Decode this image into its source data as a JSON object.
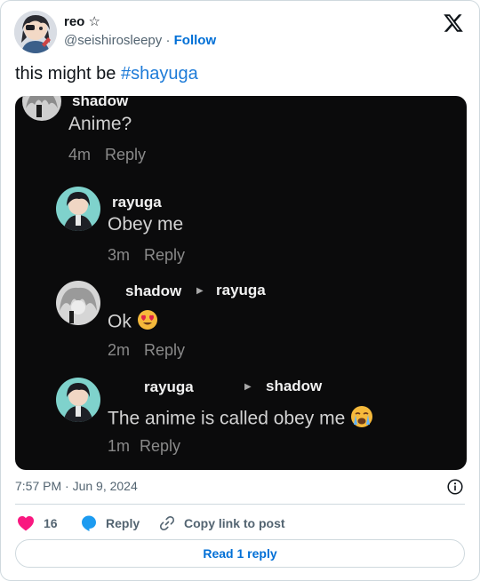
{
  "author": {
    "name": "reo",
    "badge": "☆",
    "handle": "@seishirosleepy",
    "separator": "·",
    "follow_label": "Follow"
  },
  "tweet": {
    "text": "this might be ",
    "hashtag": "#shayuga"
  },
  "media": {
    "comments": [
      {
        "user": "shadow",
        "text": "Anime?",
        "time": "4m",
        "reply": "Reply"
      },
      {
        "user": "rayuga",
        "text": "Obey me",
        "time": "3m",
        "reply": "Reply"
      },
      {
        "user": "shadow",
        "to": "rayuga",
        "text": "Ok",
        "emoji": "heart-eyes",
        "time": "2m",
        "reply": "Reply"
      },
      {
        "user": "rayuga",
        "to": "shadow",
        "text": "The anime is called obey me",
        "emoji": "crying",
        "time": "1m",
        "reply": "Reply"
      }
    ]
  },
  "footer": {
    "timestamp": "7:57 PM · Jun 9, 2024",
    "like_count": "16",
    "reply_label": "Reply",
    "copy_label": "Copy link to post",
    "read_replies_label": "Read 1 reply"
  },
  "colors": {
    "accent": "#006fd6",
    "hashtag": "#1d7bd8",
    "like": "#f91880",
    "reply_icon": "#1d9bf0",
    "media_bg": "#0b0b0c"
  }
}
